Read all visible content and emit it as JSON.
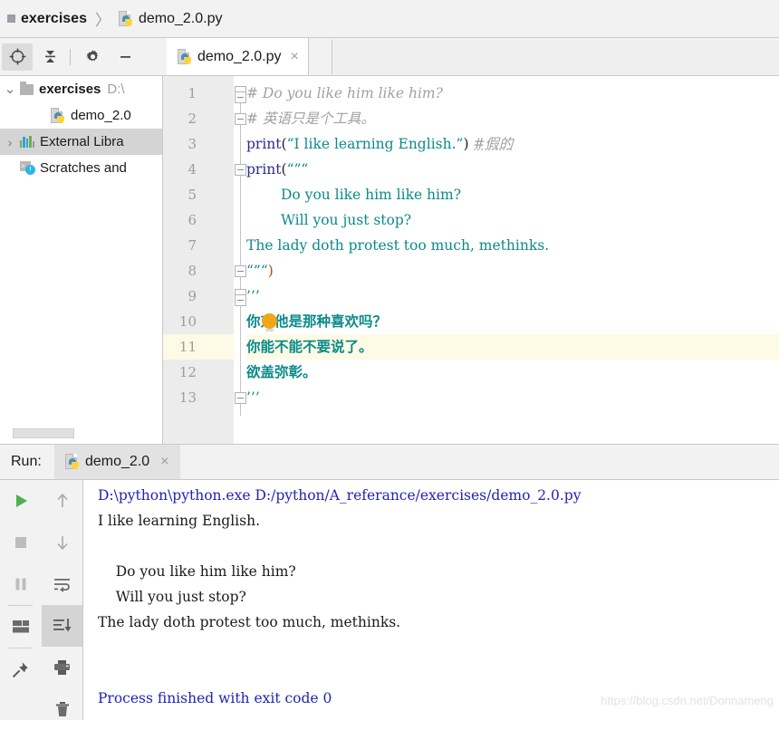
{
  "breadcrumb": {
    "project": "exercises",
    "separator": "〉",
    "file": "demo_2.0.py"
  },
  "toolbar": {
    "locate_icon": "crosshair-target-icon",
    "collapse_icon": "collapse-all-icon",
    "settings_icon": "gear-icon",
    "hide_icon": "minimize-icon"
  },
  "editor_tabs": [
    {
      "label": "demo_2.0.py",
      "close": "×",
      "icon": "python-file-icon",
      "active": true
    }
  ],
  "project_tree": [
    {
      "label": "exercises",
      "path": "D:\\",
      "expanded": true,
      "chevron": "⌄",
      "icon": "folder-icon",
      "bold": true,
      "selected": false,
      "indent": 0
    },
    {
      "label": "demo_2.0",
      "path": "",
      "expanded": false,
      "chevron": "",
      "icon": "python-file-icon",
      "bold": false,
      "selected": false,
      "indent": 1
    },
    {
      "label": "External Libra",
      "path": "",
      "expanded": false,
      "chevron": "›",
      "icon": "library-bars-icon",
      "bold": false,
      "selected": true,
      "indent": 0
    },
    {
      "label": "Scratches and",
      "path": "",
      "expanded": false,
      "chevron": "",
      "icon": "scratches-clock-icon",
      "bold": false,
      "selected": false,
      "indent": 0
    }
  ],
  "code": {
    "highlighted_line": 11,
    "bulb_line": 10,
    "lines": [
      {
        "n": 1,
        "indent": 0,
        "fold": "cap-top",
        "tokens": [
          {
            "t": "# Do you like him like him?",
            "c": "cmt"
          }
        ]
      },
      {
        "n": 2,
        "indent": 0,
        "fold": "box",
        "tokens": [
          {
            "t": "# 英语只是个工具。",
            "c": "cmt"
          }
        ]
      },
      {
        "n": 3,
        "indent": 0,
        "fold": "",
        "tokens": [
          {
            "t": "print",
            "c": "kw"
          },
          {
            "t": "(",
            "c": "punc"
          },
          {
            "t": "“I like learning English.”",
            "c": "str"
          },
          {
            "t": ")",
            "c": "punc"
          },
          {
            "t": " ",
            "c": "punc"
          },
          {
            "t": "#假的",
            "c": "cmt squig"
          }
        ]
      },
      {
        "n": 4,
        "indent": 0,
        "fold": "box",
        "tokens": [
          {
            "t": "print",
            "c": "kw"
          },
          {
            "t": "(",
            "c": "punc"
          },
          {
            "t": "“”“",
            "c": "str"
          }
        ]
      },
      {
        "n": 5,
        "indent": 2,
        "fold": "",
        "tokens": [
          {
            "t": "Do you like him like him?",
            "c": "str"
          }
        ]
      },
      {
        "n": 6,
        "indent": 2,
        "fold": "",
        "tokens": [
          {
            "t": "Will you just stop?",
            "c": "str"
          }
        ]
      },
      {
        "n": 7,
        "indent": 0,
        "fold": "",
        "tokens": [
          {
            "t": "The lady doth protest too much, methinks.",
            "c": "str"
          }
        ]
      },
      {
        "n": 8,
        "indent": 0,
        "fold": "box",
        "tokens": [
          {
            "t": "“”“",
            "c": "str"
          },
          {
            "t": ")",
            "c": "paren"
          }
        ]
      },
      {
        "n": 9,
        "indent": 0,
        "fold": "cap-top",
        "tokens": [
          {
            "t": "’’’",
            "c": "str"
          }
        ]
      },
      {
        "n": 10,
        "indent": 0,
        "fold": "",
        "tokens": [
          {
            "t": "你对他是那种喜欢吗？",
            "c": "cn"
          }
        ]
      },
      {
        "n": 11,
        "indent": 0,
        "fold": "",
        "tokens": [
          {
            "t": "你能不能不要说了。",
            "c": "cn"
          }
        ]
      },
      {
        "n": 12,
        "indent": 0,
        "fold": "",
        "tokens": [
          {
            "t": "欲盖弥彰。",
            "c": "cn"
          }
        ]
      },
      {
        "n": 13,
        "indent": 0,
        "fold": "box",
        "tokens": [
          {
            "t": "’’’",
            "c": "str"
          }
        ]
      }
    ]
  },
  "run": {
    "label": "Run:",
    "tab_label": "demo_2.0",
    "tab_close": "×",
    "tab_icon": "python-file-icon",
    "tools_col1": [
      "run-icon",
      "stop-icon",
      "pause-icon",
      "layout-icon",
      "pin-icon"
    ],
    "tools_col2": [
      "arrow-up-icon",
      "arrow-down-icon",
      "soft-wrap-icon",
      "scroll-to-end-icon",
      "print-icon",
      "trash-icon"
    ],
    "active_tool": "scroll-to-end-icon"
  },
  "console": {
    "lines": [
      {
        "text": "D:\\python\\python.exe D:/python/A_referance/exercises/demo_2.0.py",
        "color": "blue"
      },
      {
        "text": "I like learning English.",
        "color": "black"
      },
      {
        "text": "",
        "color": "black"
      },
      {
        "text": "    Do you like him like him?",
        "color": "black"
      },
      {
        "text": "    Will you just stop?",
        "color": "black"
      },
      {
        "text": "The lady doth protest too much, methinks.",
        "color": "black"
      },
      {
        "text": "",
        "color": "black"
      },
      {
        "text": "",
        "color": "black"
      },
      {
        "text": "Process finished with exit code 0",
        "color": "blue"
      }
    ]
  },
  "watermark": "https://blog.csdn.net/Donnameng",
  "colors": {
    "keyword": "#2e2e8f",
    "string": "#0c8a8a",
    "comment": "#a0a0a0",
    "console_blue": "#2222b8",
    "caret_line": "#fdfbe6",
    "selection": "#d4d4d4",
    "bulb": "#f0a819"
  }
}
